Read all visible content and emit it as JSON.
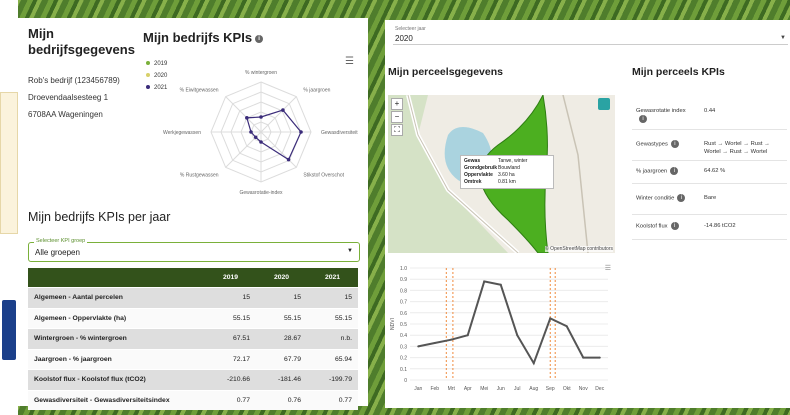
{
  "left": {
    "company": {
      "title": "Mijn bedrijfsgegevens",
      "name": "Rob's bedrijf (123456789)",
      "street": "Droevendaalsesteeg 1",
      "city": "6708AA Wageningen"
    },
    "kpis": {
      "title": "Mijn bedrijfs KPIs",
      "legend": [
        "2019",
        "2020",
        "2021"
      ],
      "axes": [
        "% wintergroen",
        "% jaargroen",
        "Gewasdiversiteit",
        "Stikstof Overschot",
        "Gewasrotatie-index",
        "% Rustgewassen",
        "% Werkjegewassen",
        "% Eiwitgewassen"
      ]
    },
    "per_year": {
      "title": "Mijn bedrijfs KPIs per jaar",
      "select_label": "Selecteer KPI groep",
      "select_value": "Alle groepen",
      "columns": [
        "",
        "2019",
        "2020",
        "2021"
      ],
      "rows": [
        [
          "Algemeen - Aantal percelen",
          "15",
          "15",
          "15"
        ],
        [
          "Algemeen - Oppervlakte (ha)",
          "55.15",
          "55.15",
          "55.15"
        ],
        [
          "Wintergroen - % wintergroen",
          "67.51",
          "28.67",
          "n.b."
        ],
        [
          "Jaargroen - % jaargroen",
          "72.17",
          "67.79",
          "65.94"
        ],
        [
          "Koolstof flux - Koolstof flux (tCO2)",
          "-210.66",
          "-181.46",
          "-199.79"
        ],
        [
          "Gewasdiversiteit - Gewasdiversiteitsindex",
          "0.77",
          "0.76",
          "0.77"
        ]
      ]
    }
  },
  "right": {
    "year_select": {
      "label": "Selecteer jaar",
      "value": "2020"
    },
    "parcel_title": "Mijn perceelsgegevens",
    "popup": [
      [
        "Gewas",
        "Tarwe, winter"
      ],
      [
        "Grondgebruik",
        "Bouwland"
      ],
      [
        "Oppervlakte",
        "3.60 ha"
      ],
      [
        "Omtrek",
        "0.81 km"
      ]
    ],
    "attribution": "© OpenStreetMap contributors",
    "parcel_kpis_title": "Mijn perceels KPIs",
    "parcel_kpis": [
      [
        "Gewasrotatie index",
        "0.44"
      ],
      [
        "Gewastypes",
        "Rust → Wortel → Rust → Wortel → Rust → Wortel"
      ],
      [
        "% jaargroen",
        "64.62 %"
      ],
      [
        "Winter conditie",
        "Bare"
      ],
      [
        "Koolstof flux",
        "-14.86 tCO2"
      ]
    ]
  },
  "colors": {
    "accent": "#33521b",
    "parcel": "#4caf20",
    "line": "#555555"
  },
  "chart_data": {
    "type": "line",
    "x": [
      "Jan",
      "Feb",
      "Mrt",
      "Apr",
      "Mei",
      "Jun",
      "Jul",
      "Aug",
      "Sep",
      "Okt",
      "Nov",
      "Dec"
    ],
    "ylabel": "NDVI",
    "ylim": [
      0,
      1
    ],
    "yticks": [
      "0",
      "0.1",
      "0.2",
      "0.3",
      "0.4",
      "0.5",
      "0.6",
      "0.7",
      "0.8",
      "0.9",
      "1.0"
    ],
    "series": [
      {
        "values": [
          0.3,
          0.33,
          0.36,
          0.4,
          0.88,
          0.85,
          0.4,
          0.15,
          0.55,
          0.48,
          0.2,
          0.2
        ]
      }
    ]
  }
}
